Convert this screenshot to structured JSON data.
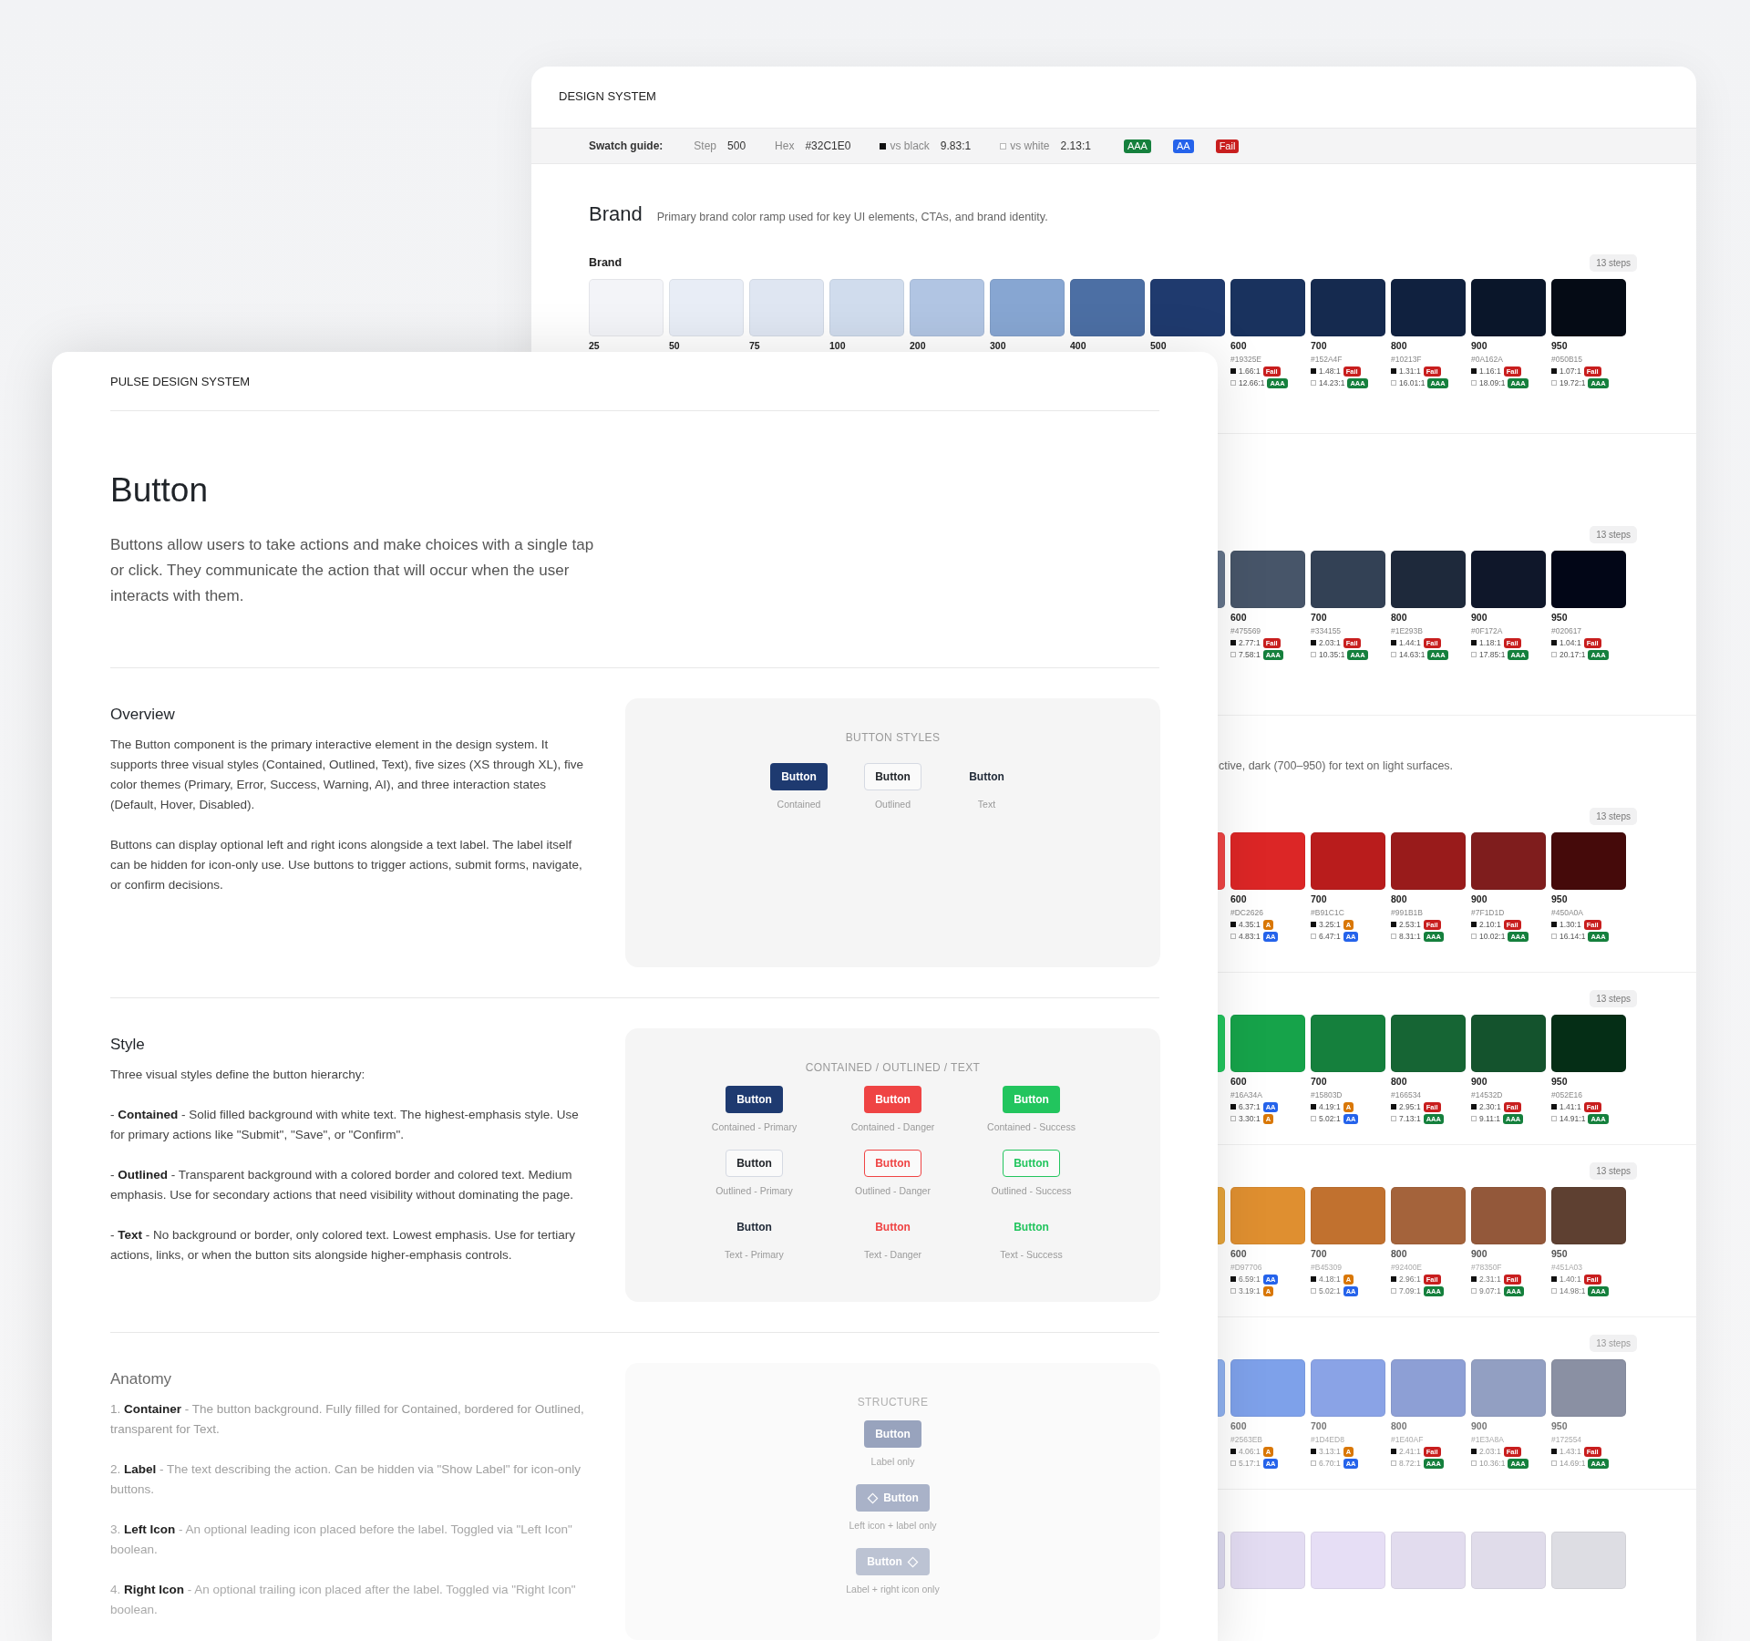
{
  "back_window": {
    "title": "DESIGN SYSTEM",
    "swatch_guide": {
      "label": "Swatch guide:",
      "fields": [
        {
          "kind": "plain",
          "key": "Step",
          "value": "500"
        },
        {
          "kind": "plain",
          "key": "Hex",
          "value": "#32C1E0"
        },
        {
          "kind": "black",
          "key": "vs black",
          "value": "9.83:1"
        },
        {
          "kind": "white",
          "key": "vs white",
          "value": "2.13:1"
        }
      ],
      "grades": [
        {
          "text": "AAA",
          "kind": "aaa"
        },
        {
          "text": "AA",
          "kind": "aa"
        },
        {
          "text": "Fail",
          "kind": "fail"
        }
      ]
    },
    "section": {
      "title": "Brand",
      "description": "Primary brand color ramp used for key UI elements, CTAs, and brand identity."
    },
    "ramps": [
      {
        "kind": "named",
        "name": "Brand",
        "badge": "13 steps",
        "steps": [
          {
            "label": "25",
            "color": "#f3f4f8"
          },
          {
            "label": "50",
            "color": "#e8edf6"
          },
          {
            "label": "75",
            "color": "#dfe6f2"
          },
          {
            "label": "100",
            "color": "#d0dced"
          },
          {
            "label": "200",
            "color": "#b1c5e3"
          },
          {
            "label": "300",
            "color": "#87a6d2"
          },
          {
            "label": "400",
            "color": "#4c6fa4"
          },
          {
            "label": "500",
            "color": "#1f3a6e"
          },
          {
            "label": "600",
            "color": "#19325e",
            "hex": "#19325E",
            "black": "1.66:1",
            "black_grade": {
              "text": "Fail",
              "kind": "fail"
            },
            "white": "12.66:1",
            "white_grade": {
              "text": "AAA",
              "kind": "aaa"
            }
          },
          {
            "label": "700",
            "color": "#152a4f",
            "hex": "#152A4F",
            "black": "1.48:1",
            "black_grade": {
              "text": "Fail",
              "kind": "fail"
            },
            "white": "14.23:1",
            "white_grade": {
              "text": "AAA",
              "kind": "aaa"
            }
          },
          {
            "label": "800",
            "color": "#10213f",
            "hex": "#10213F",
            "black": "1.31:1",
            "black_grade": {
              "text": "Fail",
              "kind": "fail"
            },
            "white": "16.01:1",
            "white_grade": {
              "text": "AAA",
              "kind": "aaa"
            }
          },
          {
            "label": "900",
            "color": "#0a162a",
            "hex": "#0A162A",
            "black": "1.16:1",
            "black_grade": {
              "text": "Fail",
              "kind": "fail"
            },
            "white": "18.09:1",
            "white_grade": {
              "text": "AAA",
              "kind": "aaa"
            }
          },
          {
            "label": "950",
            "color": "#050b15",
            "hex": "#050B15",
            "black": "1.07:1",
            "black_grade": {
              "text": "Fail",
              "kind": "fail"
            },
            "white": "19.72:1",
            "white_grade": {
              "text": "AAA",
              "kind": "aaa"
            }
          }
        ]
      },
      {
        "kind": "section",
        "badge": "13 steps",
        "steps": [
          {
            "color": "#64748b"
          },
          {
            "label": "600",
            "color": "#475569",
            "hex": "#475569",
            "black": "2.77:1",
            "black_grade": {
              "text": "Fail",
              "kind": "fail"
            },
            "white": "7.58:1",
            "white_grade": {
              "text": "AAA",
              "kind": "aaa"
            }
          },
          {
            "label": "700",
            "color": "#334155",
            "hex": "#334155",
            "black": "2.03:1",
            "black_grade": {
              "text": "Fail",
              "kind": "fail"
            },
            "white": "10.35:1",
            "white_grade": {
              "text": "AAA",
              "kind": "aaa"
            }
          },
          {
            "label": "800",
            "color": "#1e293b",
            "hex": "#1E293B",
            "black": "1.44:1",
            "black_grade": {
              "text": "Fail",
              "kind": "fail"
            },
            "white": "14.63:1",
            "white_grade": {
              "text": "AAA",
              "kind": "aaa"
            }
          },
          {
            "label": "900",
            "color": "#0f172a",
            "hex": "#0F172A",
            "black": "1.18:1",
            "black_grade": {
              "text": "Fail",
              "kind": "fail"
            },
            "white": "17.85:1",
            "white_grade": {
              "text": "AAA",
              "kind": "aaa"
            }
          },
          {
            "label": "950",
            "color": "#020617",
            "hex": "#020617",
            "black": "1.04:1",
            "black_grade": {
              "text": "Fail",
              "kind": "fail"
            },
            "white": "20.17:1",
            "white_grade": {
              "text": "AAA",
              "kind": "aaa"
            }
          }
        ]
      },
      {
        "kind": "section",
        "description": "ctive, dark (700–950) for text on light surfaces.",
        "badge": "13 steps",
        "steps": [
          {
            "color": "#ef4444"
          },
          {
            "label": "600",
            "color": "#dc2626",
            "hex": "#DC2626",
            "black": "4.35:1",
            "black_grade": {
              "text": "A",
              "kind": "a"
            },
            "white": "4.83:1",
            "white_grade": {
              "text": "AA",
              "kind": "aa"
            }
          },
          {
            "label": "700",
            "color": "#b91c1c",
            "hex": "#B91C1C",
            "black": "3.25:1",
            "black_grade": {
              "text": "A",
              "kind": "a"
            },
            "white": "6.47:1",
            "white_grade": {
              "text": "AA",
              "kind": "aa"
            }
          },
          {
            "label": "800",
            "color": "#991b1b",
            "hex": "#991B1B",
            "black": "2.53:1",
            "black_grade": {
              "text": "Fail",
              "kind": "fail"
            },
            "white": "8.31:1",
            "white_grade": {
              "text": "AAA",
              "kind": "aaa"
            }
          },
          {
            "label": "900",
            "color": "#7f1d1d",
            "hex": "#7F1D1D",
            "black": "2.10:1",
            "black_grade": {
              "text": "Fail",
              "kind": "fail"
            },
            "white": "10.02:1",
            "white_grade": {
              "text": "AAA",
              "kind": "aaa"
            }
          },
          {
            "label": "950",
            "color": "#450a0a",
            "hex": "#450A0A",
            "black": "1.30:1",
            "black_grade": {
              "text": "Fail",
              "kind": "fail"
            },
            "white": "16.14:1",
            "white_grade": {
              "text": "AAA",
              "kind": "aaa"
            }
          }
        ]
      },
      {
        "kind": "plain",
        "badge": "13 steps",
        "steps": [
          {
            "color": "#22c55e"
          },
          {
            "label": "600",
            "color": "#16a34a",
            "hex": "#16A34A",
            "black": "6.37:1",
            "black_grade": {
              "text": "AA",
              "kind": "aa"
            },
            "white": "3.30:1",
            "white_grade": {
              "text": "A",
              "kind": "a"
            }
          },
          {
            "label": "700",
            "color": "#15803d",
            "hex": "#15803D",
            "black": "4.19:1",
            "black_grade": {
              "text": "A",
              "kind": "a"
            },
            "white": "5.02:1",
            "white_grade": {
              "text": "AA",
              "kind": "aa"
            }
          },
          {
            "label": "800",
            "color": "#166534",
            "hex": "#166534",
            "black": "2.95:1",
            "black_grade": {
              "text": "Fail",
              "kind": "fail"
            },
            "white": "7.13:1",
            "white_grade": {
              "text": "AAA",
              "kind": "aaa"
            }
          },
          {
            "label": "900",
            "color": "#14532d",
            "hex": "#14532D",
            "black": "2.30:1",
            "black_grade": {
              "text": "Fail",
              "kind": "fail"
            },
            "white": "9.11:1",
            "white_grade": {
              "text": "AAA",
              "kind": "aaa"
            }
          },
          {
            "label": "950",
            "color": "#052e16",
            "hex": "#052E16",
            "black": "1.41:1",
            "black_grade": {
              "text": "Fail",
              "kind": "fail"
            },
            "white": "14.91:1",
            "white_grade": {
              "text": "AAA",
              "kind": "aaa"
            }
          }
        ]
      },
      {
        "kind": "soft",
        "badge": "13 steps",
        "steps": [
          {
            "color": "#e6a43a"
          },
          {
            "label": "600",
            "color": "#df8f30",
            "hex": "#D97706",
            "black": "6.59:1",
            "black_grade": {
              "text": "AA",
              "kind": "aa"
            },
            "white": "3.19:1",
            "white_grade": {
              "text": "A",
              "kind": "a"
            }
          },
          {
            "label": "700",
            "color": "#c1712f",
            "hex": "#B45309",
            "black": "4.18:1",
            "black_grade": {
              "text": "A",
              "kind": "a"
            },
            "white": "5.02:1",
            "white_grade": {
              "text": "AA",
              "kind": "aa"
            }
          },
          {
            "label": "800",
            "color": "#a4633b",
            "hex": "#92400E",
            "black": "2.96:1",
            "black_grade": {
              "text": "Fail",
              "kind": "fail"
            },
            "white": "7.09:1",
            "white_grade": {
              "text": "AAA",
              "kind": "aaa"
            }
          },
          {
            "label": "900",
            "color": "#93583a",
            "hex": "#78350F",
            "black": "2.31:1",
            "black_grade": {
              "text": "Fail",
              "kind": "fail"
            },
            "white": "9.07:1",
            "white_grade": {
              "text": "AAA",
              "kind": "aaa"
            }
          },
          {
            "label": "950",
            "color": "#5e4031",
            "hex": "#451A03",
            "black": "1.40:1",
            "black_grade": {
              "text": "Fail",
              "kind": "fail"
            },
            "white": "14.98:1",
            "white_grade": {
              "text": "AAA",
              "kind": "aaa"
            }
          }
        ]
      },
      {
        "kind": "pale",
        "badge": "13 steps",
        "steps": [
          {
            "color": "#8fb1f0"
          },
          {
            "label": "600",
            "color": "#7ea1ea",
            "hex": "#2563EB",
            "black": "4.06:1",
            "black_grade": {
              "text": "A",
              "kind": "a"
            },
            "white": "5.17:1",
            "white_grade": {
              "text": "AA",
              "kind": "aa"
            }
          },
          {
            "label": "700",
            "color": "#8aa3e6",
            "hex": "#1D4ED8",
            "black": "3.13:1",
            "black_grade": {
              "text": "A",
              "kind": "a"
            },
            "white": "6.70:1",
            "white_grade": {
              "text": "AA",
              "kind": "aa"
            }
          },
          {
            "label": "800",
            "color": "#8d9fd5",
            "hex": "#1E40AF",
            "black": "2.41:1",
            "black_grade": {
              "text": "Fail",
              "kind": "fail"
            },
            "white": "8.72:1",
            "white_grade": {
              "text": "AAA",
              "kind": "aaa"
            }
          },
          {
            "label": "900",
            "color": "#929fc2",
            "hex": "#1E3A8A",
            "black": "2.03:1",
            "black_grade": {
              "text": "Fail",
              "kind": "fail"
            },
            "white": "10.36:1",
            "white_grade": {
              "text": "AAA",
              "kind": "aaa"
            }
          },
          {
            "label": "950",
            "color": "#8a90a3",
            "hex": "#172554",
            "black": "1.43:1",
            "black_grade": {
              "text": "Fail",
              "kind": "fail"
            },
            "white": "14.69:1",
            "white_grade": {
              "text": "AAA",
              "kind": "aaa"
            }
          }
        ]
      },
      {
        "kind": "faded",
        "steps": [
          {
            "color": "#dcd9ef"
          },
          {
            "color": "#e3dcf2"
          },
          {
            "color": "#e6def5"
          },
          {
            "color": "#e2dcee"
          },
          {
            "color": "#e0dcea"
          },
          {
            "color": "#dddde3"
          }
        ]
      }
    ]
  },
  "front_window": {
    "title": "PULSE DESIGN SYSTEM",
    "heading": "Button",
    "intro": "Buttons allow users to take actions and make choices with a single tap or click. They communicate the action that will occur when the user interacts with them.",
    "sections": [
      {
        "kind": "overview",
        "title": "Overview",
        "paragraphs": [
          "The Button component is the primary interactive element in the design system. It supports three visual styles (Contained, Outlined, Text), five sizes (XS through XL), five color themes (Primary, Error, Success, Warning, AI), and three interaction states (Default, Hover, Disabled).",
          "Buttons can display optional left and right icons alongside a text label. The label itself can be hidden for icon-only use. Use buttons to trigger actions, submit forms, navigate, or confirm decisions."
        ],
        "panel": {
          "caption": "BUTTON STYLES",
          "items": [
            {
              "kind": "contained_primary",
              "label": "Button",
              "caption": "Contained"
            },
            {
              "kind": "outlined_primary",
              "label": "Button",
              "caption": "Outlined"
            },
            {
              "kind": "text_primary",
              "label": "Button",
              "caption": "Text"
            }
          ]
        }
      },
      {
        "kind": "style",
        "title": "Style",
        "paragraphs": [
          "Three visual styles define the button hierarchy:",
          "- **Contained** - Solid filled background with white text. The highest-emphasis style. Use for primary actions like \"Submit\", \"Save\", or \"Confirm\".",
          "- **Outlined** - Transparent background with a colored border and colored text. Medium emphasis. Use for secondary actions that need visibility without dominating the page.",
          "- **Text** - No background or border, only colored text. Lowest emphasis. Use for tertiary actions, links, or when the button sits alongside higher-emphasis controls."
        ],
        "panel": {
          "caption": "CONTAINED / OUTLINED / TEXT",
          "items": [
            {
              "kind": "contained_primary",
              "label": "Button",
              "caption": "Contained - Primary"
            },
            {
              "kind": "contained_danger",
              "label": "Button",
              "caption": "Contained - Danger"
            },
            {
              "kind": "contained_success",
              "label": "Button",
              "caption": "Contained - Success"
            },
            {
              "kind": "outlined_primary",
              "label": "Button",
              "caption": "Outlined - Primary"
            },
            {
              "kind": "outlined_danger",
              "label": "Button",
              "caption": "Outlined - Danger"
            },
            {
              "kind": "outlined_success",
              "label": "Button",
              "caption": "Outlined - Success"
            },
            {
              "kind": "text_primary",
              "label": "Button",
              "caption": "Text - Primary"
            },
            {
              "kind": "text_danger",
              "label": "Button",
              "caption": "Text - Danger"
            },
            {
              "kind": "text_success",
              "label": "Button",
              "caption": "Text - Success"
            }
          ]
        }
      },
      {
        "kind": "anatomy",
        "title": "Anatomy",
        "paragraphs": [
          "1. **Container** - The button background. Fully filled for Contained, bordered for Outlined, transparent for Text.",
          "2. **Label** - The text describing the action. Can be hidden via \"Show Label\" for icon-only buttons.",
          "3. **Left Icon** - An optional leading icon placed before the label. Toggled via \"Left Icon\" boolean.",
          "4. **Right Icon** - An optional trailing icon placed after the label. Toggled via \"Right Icon\" boolean."
        ],
        "panel": {
          "caption": "STRUCTURE",
          "items": [
            {
              "kind": "label_only",
              "label": "Button",
              "caption": "Label only"
            },
            {
              "kind": "left_icon",
              "label": "Button",
              "caption": "Left icon + label only"
            },
            {
              "kind": "right_icon",
              "label": "Button",
              "caption": "Label + right icon only"
            }
          ]
        }
      }
    ]
  }
}
